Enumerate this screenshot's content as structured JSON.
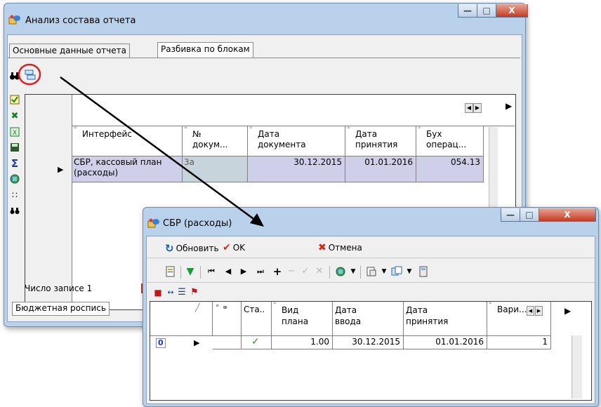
{
  "main_window": {
    "title": "Анализ состава отчета",
    "tabs": [
      {
        "label": "Основные данные отчета"
      },
      {
        "label": "Разбивка по блокам"
      }
    ],
    "grid": {
      "columns": [
        "Интерфейс",
        "№ докум...",
        "Дата документа",
        "Дата принятия",
        "Бух операц..."
      ],
      "row": {
        "interface": "СБР, кассовый план (расходы)",
        "doc_no": "3а",
        "doc_date": "30.12.2015",
        "accept_date": "01.01.2016",
        "operation": "054.13"
      }
    },
    "record_count_label": "Число записе 1",
    "bottom_tab": "Бюджетная роспись"
  },
  "child_window": {
    "title": "СБР (расходы)",
    "actions": {
      "refresh": "Обновить",
      "ok": "OK",
      "cancel": "Отмена"
    },
    "grid": {
      "columns": [
        "Ста..",
        "Вид плана",
        "Дата ввода",
        "Дата принятия",
        "Вари..."
      ],
      "row": {
        "marker": "0",
        "plan_type": "1.00",
        "input_date": "30.12.2015",
        "accept_date": "01.01.2016",
        "variant": "1"
      }
    }
  },
  "colors": {
    "highlight_circle": "#e02020",
    "selected_row": "#cfcfea",
    "ok_check": "#1f9a1f",
    "cancel_x": "#d42a12"
  }
}
